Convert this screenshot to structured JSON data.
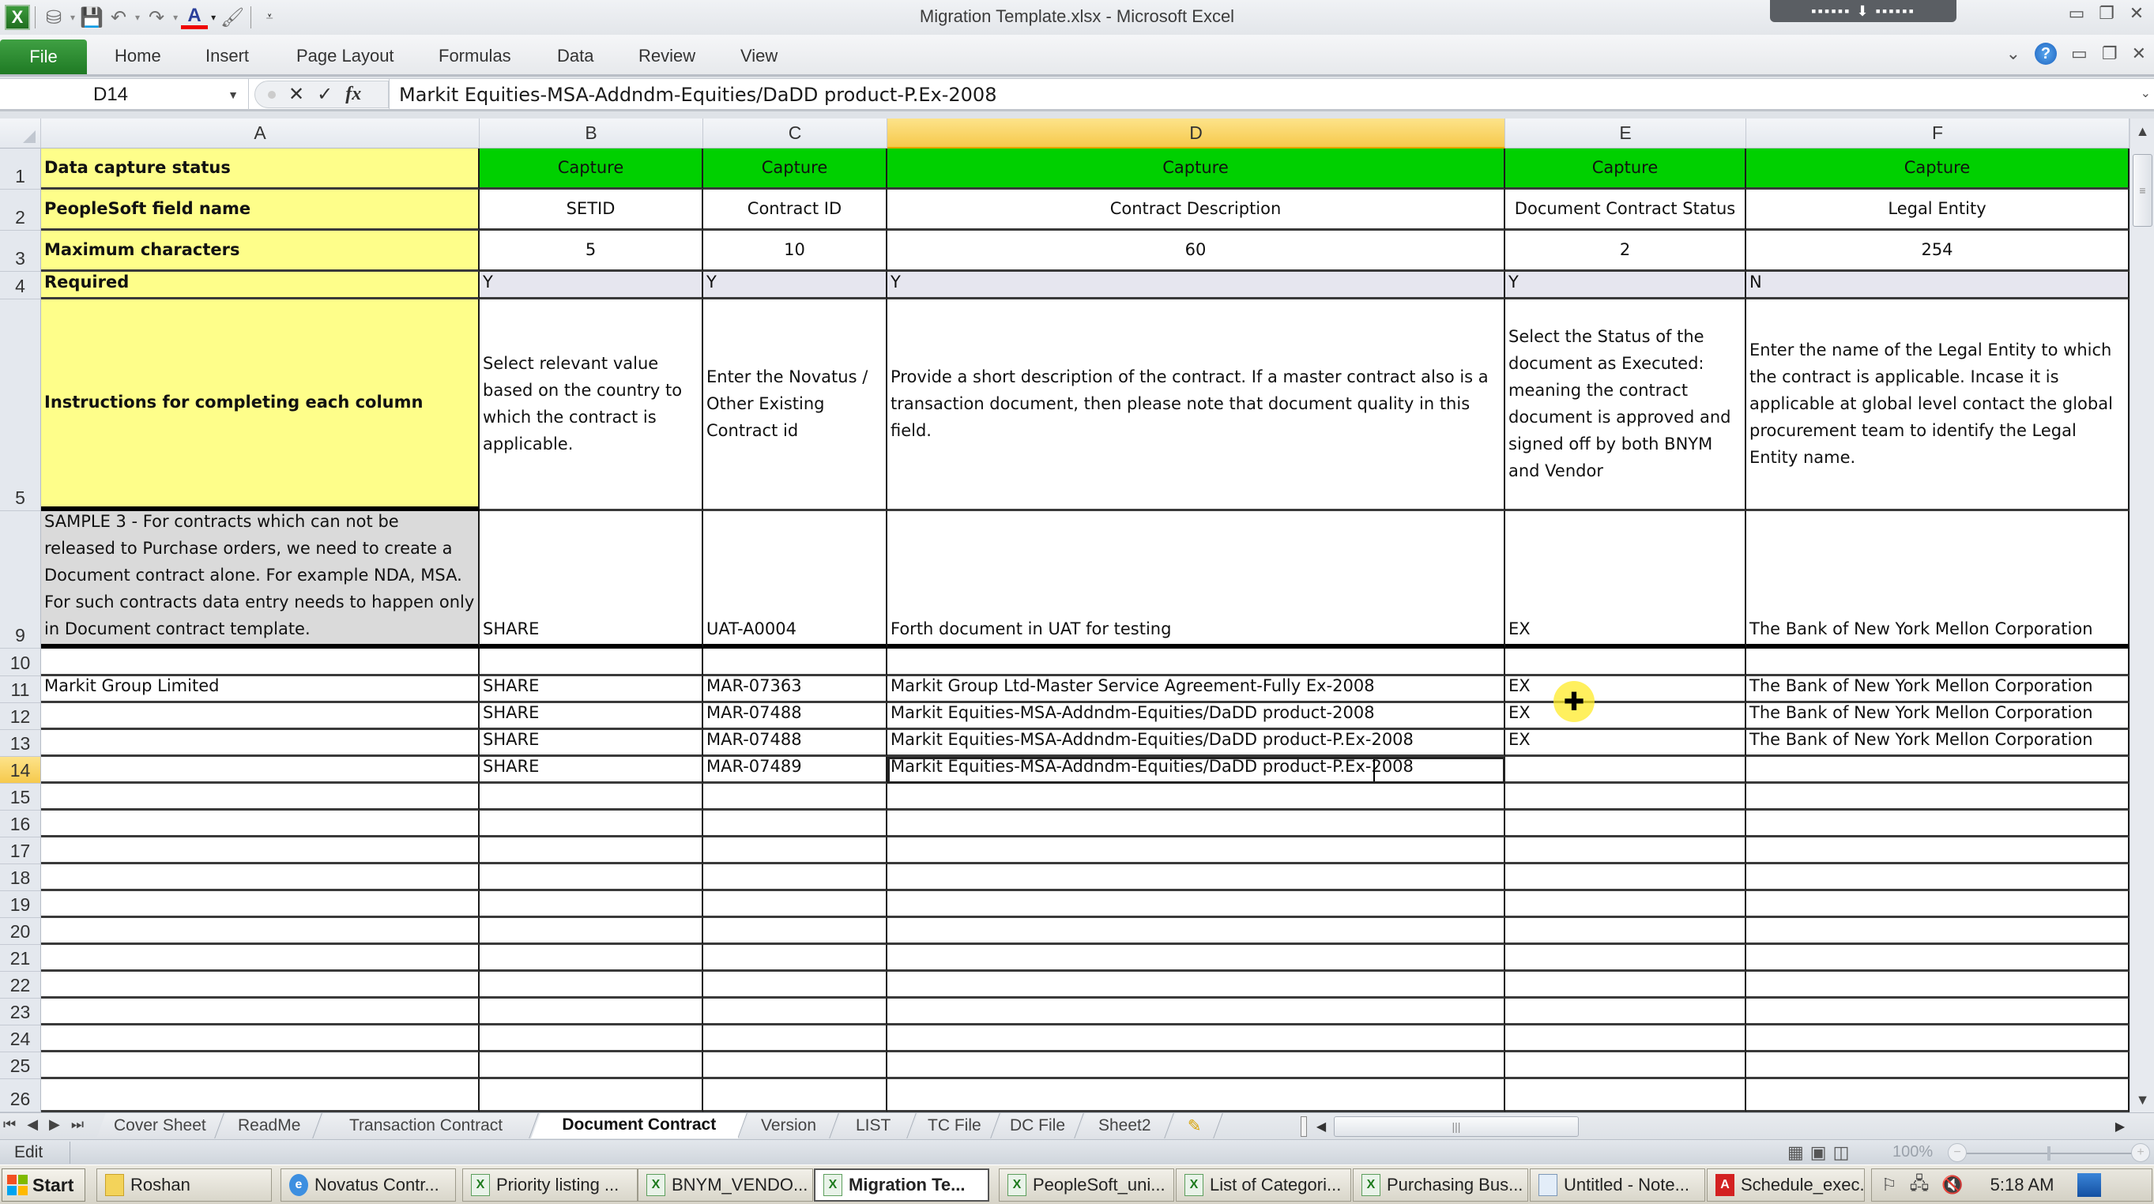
{
  "window": {
    "title": "Migration Template.xlsx  -  Microsoft Excel",
    "app_icon_label": "X",
    "remote_bar_label": "▪▪▪▪▪▪ ⬇ ▪▪▪▪▪▪"
  },
  "quick_access": {
    "icons": [
      "paint-bucket-icon",
      "save-icon",
      "undo-icon",
      "redo-icon",
      "font-color-icon",
      "format-painter-icon",
      "customize-qat-icon"
    ]
  },
  "ribbon": {
    "file_label": "File",
    "tabs": [
      "Home",
      "Insert",
      "Page Layout",
      "Formulas",
      "Data",
      "Review",
      "View"
    ]
  },
  "formula_bar": {
    "name_box": "D14",
    "cancel_symbol": "✕",
    "enter_symbol": "✓",
    "fx_label": "fx",
    "content": "Markit Equities-MSA-Addndm-Equities/DaDD product-P.Ex-2008"
  },
  "sheet": {
    "columns": [
      "A",
      "B",
      "C",
      "D",
      "E",
      "F"
    ],
    "active_column": "D",
    "active_row": "14",
    "rows": {
      "r1": {
        "num": "1",
        "A": "Data capture status",
        "B": "Capture",
        "C": "Capture",
        "D": "Capture",
        "E": "Capture",
        "F": "Capture"
      },
      "r2": {
        "num": "2",
        "A": "PeopleSoft field name",
        "B": "SETID",
        "C": "Contract ID",
        "D": "Contract Description",
        "E": "Document Contract Status",
        "F": "Legal Entity"
      },
      "r3": {
        "num": "3",
        "A": "Maximum characters",
        "B": "5",
        "C": "10",
        "D": "60",
        "E": "2",
        "F": "254"
      },
      "r4": {
        "num": "4",
        "A": "Required",
        "B": "Y",
        "C": "Y",
        "D": "Y",
        "E": "Y",
        "F": "N"
      },
      "r5": {
        "num": "5",
        "A": "Instructions for completing each column",
        "B": "Select relevant value based on the country to which the contract is applicable.",
        "C": "Enter the Novatus / Other Existing Contract id",
        "D": "Provide a short description of the contract.  If a master contract also is a transaction document, then please note that document quality in this field.",
        "E": "Select the Status of the document as Executed: meaning the contract document is approved and signed off by both BNYM and Vendor",
        "F": "Enter the name of the Legal Entity to which the contract is applicable. Incase it is applicable at global level contact the global procurement team to identify the Legal Entity name."
      },
      "r9": {
        "num": "9",
        "A": "SAMPLE 3 - For contracts which can not be released to Purchase orders, we need to create a Document contract alone. For example NDA, MSA. For such contracts data entry needs to happen only in Document contract template.",
        "B": "SHARE",
        "C": "UAT-A0004",
        "D": "Forth document in UAT for testing",
        "E": "EX",
        "F": "The Bank of New York Mellon Corporation"
      },
      "r10": {
        "num": "10",
        "A": "",
        "B": "",
        "C": "",
        "D": "",
        "E": "",
        "F": ""
      },
      "r11": {
        "num": "11",
        "A": "Markit Group Limited",
        "B": "SHARE",
        "C": "MAR-07363",
        "D": "Markit Group Ltd-Master Service Agreement-Fully Ex-2008",
        "E": "EX",
        "F": "The Bank of New York Mellon Corporation"
      },
      "r12": {
        "num": "12",
        "A": "",
        "B": "SHARE",
        "C": "MAR-07488",
        "D": "Markit Equities-MSA-Addndm-Equities/DaDD product-2008",
        "E": "EX",
        "F": "The Bank of New York Mellon Corporation"
      },
      "r13": {
        "num": "13",
        "A": "",
        "B": "SHARE",
        "C": "MAR-07488",
        "D": "Markit Equities-MSA-Addndm-Equities/DaDD product-P.Ex-2008",
        "E": "EX",
        "F": "The Bank of New York Mellon Corporation"
      },
      "r14": {
        "num": "14",
        "A": "",
        "B": "SHARE",
        "C": "MAR-07489",
        "D": "Markit Equities-MSA-Addndm-Equities/DaDD product-P.Ex-2008",
        "E": "",
        "F": ""
      }
    },
    "empty_rows": [
      "15",
      "16",
      "17",
      "18",
      "19",
      "20",
      "21",
      "22",
      "23",
      "24",
      "25",
      "26"
    ]
  },
  "colors": {
    "header_yellow": "#fefe8a",
    "capture_green": "#00d000",
    "required_row": "#e6e6ef",
    "sample_grey": "#dadada",
    "active_header": "#f6c94c"
  },
  "sheet_tabs": {
    "nav": [
      "⏮",
      "◀",
      "▶",
      "⏭"
    ],
    "tabs": [
      "Cover Sheet",
      "ReadMe",
      "Transaction Contract",
      "Document Contract",
      "Version",
      "LIST",
      "TC File",
      "DC File",
      "Sheet2"
    ],
    "active": "Document Contract",
    "insert_icon": "✎"
  },
  "status_bar": {
    "mode": "Edit",
    "zoom": "100%",
    "zoom_minus": "−",
    "zoom_plus": "+"
  },
  "taskbar": {
    "start_label": "Start",
    "items": [
      {
        "label": "Roshan",
        "icon": "folder-icon"
      },
      {
        "label": "Novatus Contr...",
        "icon": "ie-icon"
      },
      {
        "label": "Priority listing ...",
        "icon": "excel-icon"
      },
      {
        "label": "BNYM_VENDO...",
        "icon": "excel-icon"
      },
      {
        "label": "Migration Te...",
        "icon": "excel-icon",
        "active": true
      },
      {
        "label": "PeopleSoft_uni...",
        "icon": "excel-icon"
      },
      {
        "label": "List of Categori...",
        "icon": "excel-icon"
      },
      {
        "label": "Purchasing Bus...",
        "icon": "excel-icon"
      },
      {
        "label": "Untitled - Note...",
        "icon": "notepad-icon"
      },
      {
        "label": "Schedule_exec...",
        "icon": "pdf-icon"
      }
    ],
    "clock": "5:18 AM"
  }
}
